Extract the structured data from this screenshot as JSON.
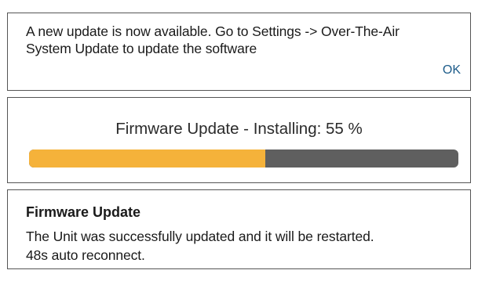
{
  "notification": {
    "message_line1": "A new update is now available. Go to Settings -> Over-The-Air",
    "message_line2": "System Update to update the software",
    "ok_label": "OK"
  },
  "progress": {
    "status_text": "Firmware Update - Installing: 55 %",
    "percent": 55,
    "fill_color": "#f5b23a",
    "track_color": "#5f5f5f"
  },
  "success": {
    "title": "Firmware Update",
    "message_line1": "The Unit was successfully updated and it will be restarted.",
    "message_line2": "48s auto reconnect."
  }
}
